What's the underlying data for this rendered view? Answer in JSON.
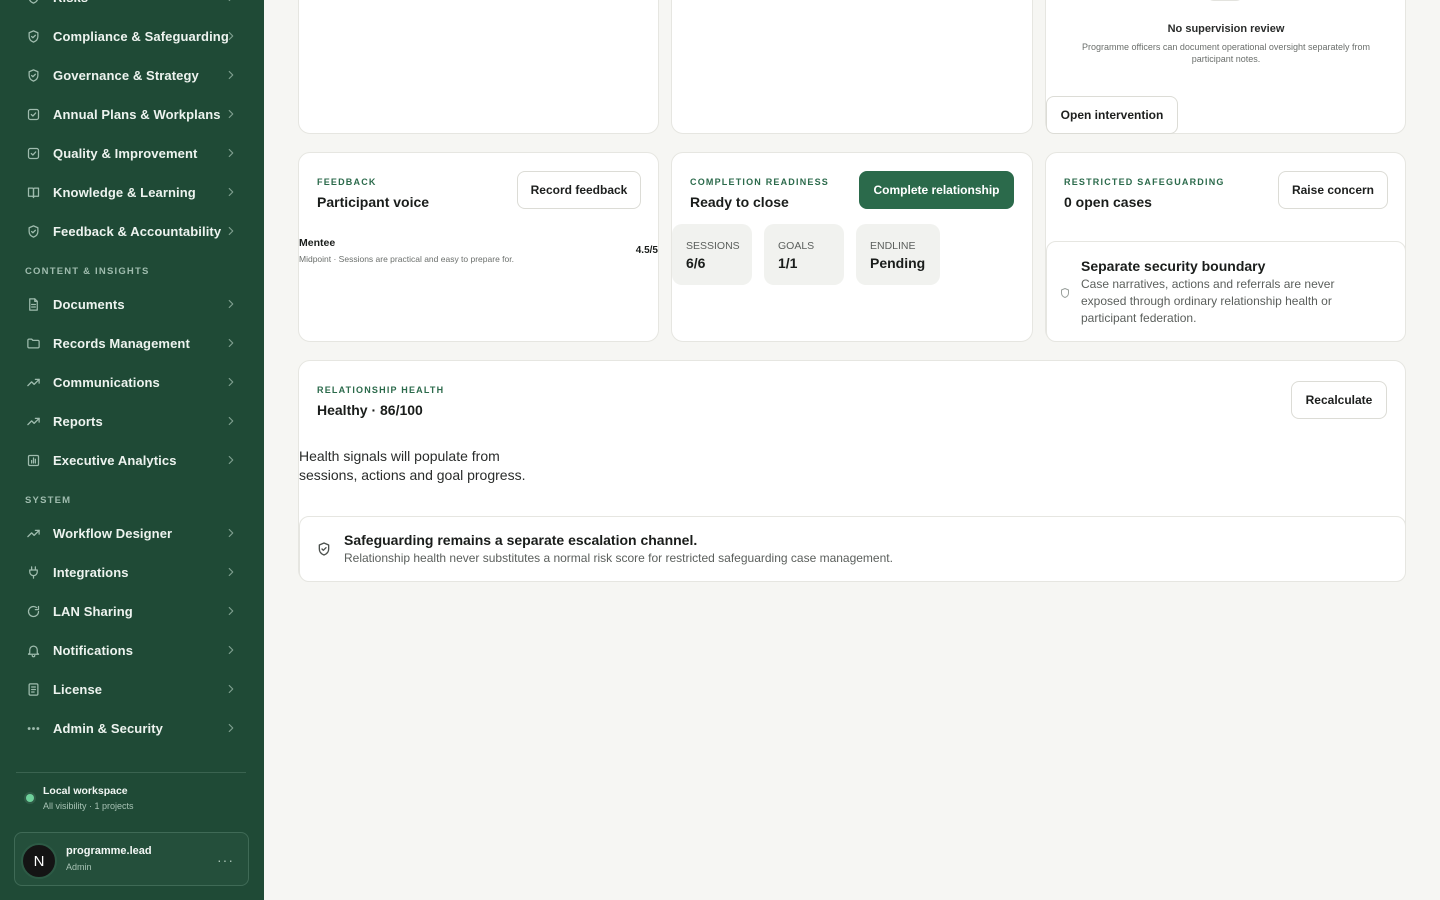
{
  "sidebar": {
    "items_top": [
      {
        "label": "Risks",
        "icon": "shield-icon"
      },
      {
        "label": "Compliance & Safeguarding",
        "icon": "shield-check-icon"
      },
      {
        "label": "Governance & Strategy",
        "icon": "shield-check-icon"
      },
      {
        "label": "Annual Plans & Workplans",
        "icon": "checkbox-icon"
      },
      {
        "label": "Quality & Improvement",
        "icon": "checkbox-icon"
      },
      {
        "label": "Knowledge & Learning",
        "icon": "book-icon"
      },
      {
        "label": "Feedback & Accountability",
        "icon": "shield-check-icon"
      }
    ],
    "section_content": "CONTENT & INSIGHTS",
    "items_content": [
      {
        "label": "Documents",
        "icon": "document-icon"
      },
      {
        "label": "Records Management",
        "icon": "folder-icon"
      },
      {
        "label": "Communications",
        "icon": "trend-icon"
      },
      {
        "label": "Reports",
        "icon": "trend-icon"
      },
      {
        "label": "Executive Analytics",
        "icon": "bar-chart-icon"
      }
    ],
    "section_system": "SYSTEM",
    "items_system": [
      {
        "label": "Workflow Designer",
        "icon": "trend-icon"
      },
      {
        "label": "Integrations",
        "icon": "plug-icon"
      },
      {
        "label": "LAN Sharing",
        "icon": "refresh-icon"
      },
      {
        "label": "Notifications",
        "icon": "bell-icon"
      },
      {
        "label": "License",
        "icon": "license-icon"
      },
      {
        "label": "Admin & Security",
        "icon": "dots-icon"
      }
    ],
    "workspace": {
      "title": "Local workspace",
      "subtitle": "All visibility · 1 projects"
    },
    "user": {
      "initial": "N",
      "name": "programme.lead",
      "role": "Admin",
      "more": "···"
    }
  },
  "top_row": {
    "supervision": {
      "empty_title": "No supervision review",
      "empty_desc": "Programme officers can document operational oversight separately from participant notes.",
      "button": "Open intervention"
    }
  },
  "feedback": {
    "eyebrow": "FEEDBACK",
    "title": "Participant voice",
    "button": "Record feedback",
    "entry": {
      "name": "Mentee",
      "text": "Midpoint · Sessions are practical and easy to prepare for.",
      "score": "4.5/5"
    }
  },
  "completion": {
    "eyebrow": "COMPLETION READINESS",
    "title": "Ready to close",
    "button": "Complete relationship",
    "stats": [
      {
        "label": "Sessions",
        "value": "6/6"
      },
      {
        "label": "Goals",
        "value": "1/1"
      },
      {
        "label": "Endline",
        "value": "Pending"
      }
    ]
  },
  "safeguarding": {
    "eyebrow": "RESTRICTED SAFEGUARDING",
    "title": "0 open cases",
    "button": "Raise concern",
    "boundary_title": "Separate security boundary",
    "boundary_desc": "Case narratives, actions and referrals are never exposed through ordinary relationship health or participant federation."
  },
  "health": {
    "eyebrow": "RELATIONSHIP HEALTH",
    "title": "Healthy · 86/100",
    "button": "Recalculate",
    "message": "Health signals will populate from sessions, actions and goal progress.",
    "banner_title": "Safeguarding remains a separate escalation channel.",
    "banner_desc": "Relationship health never substitutes a normal risk score for restricted safeguarding case management."
  }
}
